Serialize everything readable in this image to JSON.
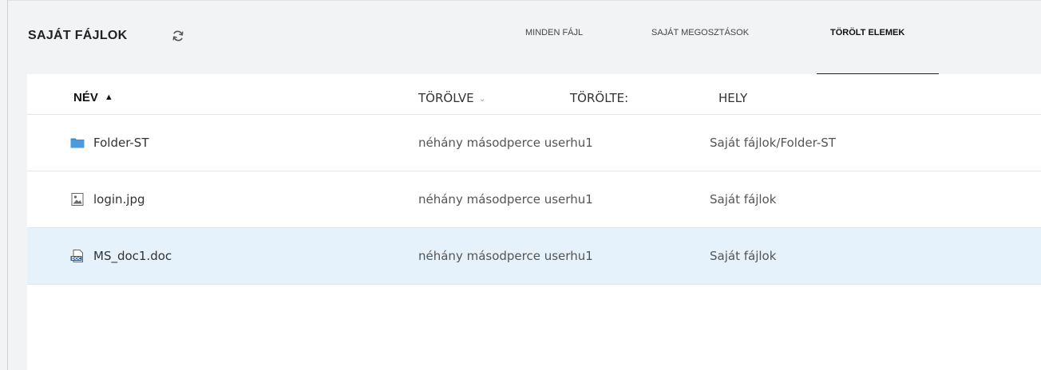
{
  "header": {
    "title": "SAJÁT FÁJLOK",
    "tabs": [
      {
        "label": "MINDEN FÁJL",
        "active": false
      },
      {
        "label": "SAJÁT MEGOSZTÁSOK",
        "active": false
      },
      {
        "label": "TÖRÖLT ELEMEK",
        "active": true
      }
    ]
  },
  "table": {
    "columns": {
      "name": "NÉV",
      "deleted": "TÖRÖLVE",
      "deleted_by": "TÖRÖLTE:",
      "location": "HELY"
    },
    "sort": {
      "column": "name",
      "direction": "ascending"
    },
    "rows": [
      {
        "icon": "folder-icon",
        "name": "Folder-ST",
        "deleted": "néhány másodperce userhu1",
        "location": "Saját fájlok/Folder-ST",
        "selected": false
      },
      {
        "icon": "image-file-icon",
        "name": "login.jpg",
        "deleted": "néhány másodperce userhu1",
        "location": "Saját fájlok",
        "selected": false
      },
      {
        "icon": "doc-file-icon",
        "name": "MS_doc1.doc",
        "deleted": "néhány másodperce userhu1",
        "location": "Saját fájlok",
        "selected": true
      }
    ]
  },
  "colors": {
    "accent_folder": "#3d8fd6",
    "selected_row": "#e5f1fb",
    "active_tab_underline": "#1f1f1f",
    "doc_icon": "#2b5797"
  }
}
